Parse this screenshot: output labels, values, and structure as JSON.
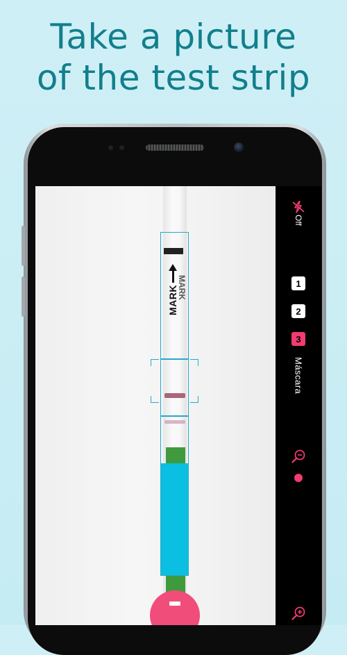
{
  "headline": {
    "line1": "Take a picture",
    "line2": "of the test strip"
  },
  "strip": {
    "mark_text": "MARK"
  },
  "controls": {
    "flash_label": "Off",
    "step_1": "1",
    "step_2": "2",
    "step_3": "3",
    "mode_label": "Máscara"
  },
  "colors": {
    "accent_pink": "#f03c6e",
    "frame_blue": "#25a9ca",
    "cyan_block": "#0abfe1",
    "handle_green": "#3f9a3d",
    "headline_teal": "#127f8c"
  },
  "icons": [
    "flash-off-icon",
    "zoom-out-icon",
    "zoom-in-icon",
    "shutter-icon"
  ]
}
